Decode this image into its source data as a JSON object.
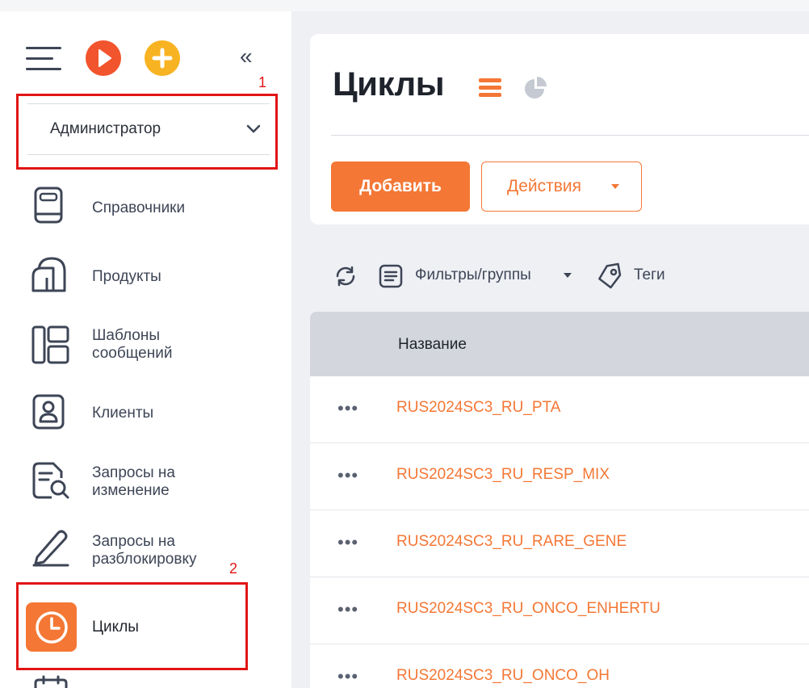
{
  "sidebar": {
    "role_select": {
      "value": "Администратор"
    },
    "annotation_1": "1",
    "annotation_2": "2",
    "items": [
      {
        "label": "Справочники",
        "icon": "book-icon"
      },
      {
        "label": "Продукты",
        "icon": "products-icon"
      },
      {
        "label": "Шаблоны сообщений",
        "line1": "Шаблоны",
        "line2": "сообщений",
        "icon": "templates-icon"
      },
      {
        "label": "Клиенты",
        "icon": "client-icon"
      },
      {
        "label": "Запросы на изменение",
        "line1": "Запросы на",
        "line2": "изменение",
        "icon": "change-request-icon"
      },
      {
        "label": "Запросы на разблокировку",
        "line1": "Запросы на",
        "line2": "разблокировку",
        "icon": "pencil-icon"
      },
      {
        "label": "Циклы",
        "icon": "clock-icon",
        "active": true
      }
    ]
  },
  "main": {
    "title": "Циклы",
    "add_button": "Добавить",
    "actions_button": "Действия",
    "toolbar": {
      "filters_label": "Фильтры/группы",
      "tags_label": "Теги"
    },
    "table": {
      "column_name": "Название",
      "rows": [
        {
          "name": "RUS2024SC3_RU_PTA"
        },
        {
          "name": "RUS2024SC3_RU_RESP_MIX"
        },
        {
          "name": "RUS2024SC3_RU_RARE_GENE"
        },
        {
          "name": "RUS2024SC3_RU_ONCO_ENHERTU"
        },
        {
          "name": "RUS2024SC3_RU_ONCO_OH"
        }
      ]
    },
    "row_menu_glyph": "•••"
  },
  "colors": {
    "accent": "#f47735",
    "annotation_red": "#e11515",
    "play_icon": "#f2542d",
    "plus_icon": "#f8b322"
  }
}
